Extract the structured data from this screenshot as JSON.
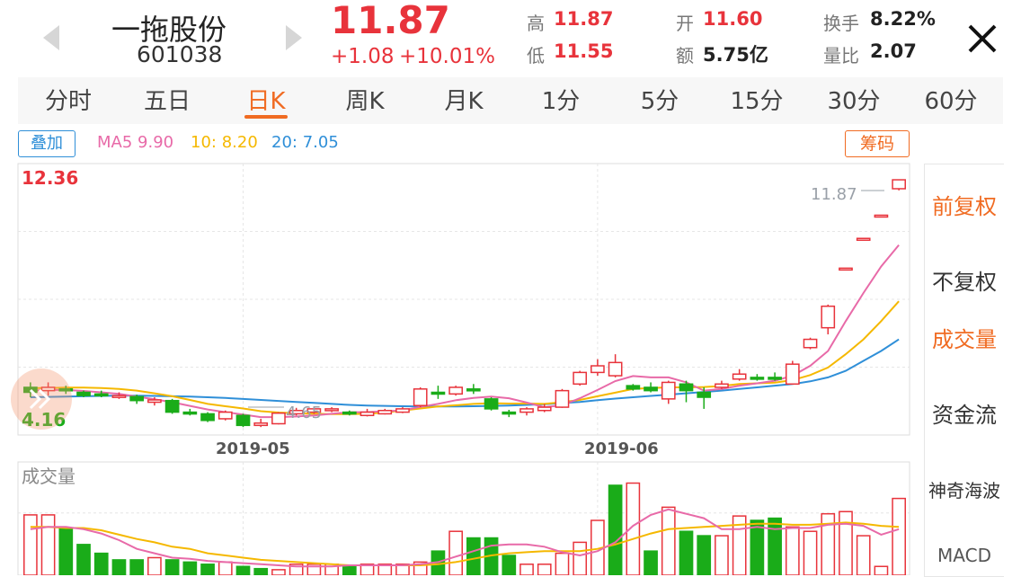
{
  "header": {
    "stock_name": "一拖股份",
    "stock_code": "601038",
    "price": "11.87",
    "change": "+1.08",
    "change_pct": "+10.01%",
    "stats": [
      {
        "label": "高",
        "value": "11.87",
        "red": true
      },
      {
        "label": "开",
        "value": "11.60",
        "red": true
      },
      {
        "label": "换手",
        "value": "8.22%",
        "red": false
      },
      {
        "label": "低",
        "value": "11.55",
        "red": true
      },
      {
        "label": "额",
        "value": "5.75亿",
        "red": false
      },
      {
        "label": "量比",
        "value": "2.07",
        "red": false
      }
    ],
    "close_icon": "close-icon",
    "prev_icon": "chevron-left-icon",
    "next_icon": "chevron-right-icon"
  },
  "tabs": [
    {
      "label": "分时",
      "active": false
    },
    {
      "label": "五日",
      "active": false
    },
    {
      "label": "日K",
      "active": true
    },
    {
      "label": "周K",
      "active": false
    },
    {
      "label": "月K",
      "active": false
    },
    {
      "label": "1分",
      "active": false
    },
    {
      "label": "5分",
      "active": false
    },
    {
      "label": "15分",
      "active": false
    },
    {
      "label": "30分",
      "active": false
    },
    {
      "label": "60分",
      "active": false
    }
  ],
  "indicator_bar": {
    "overlay_button": "叠加",
    "ma5": "MA5 9.90",
    "ma10": "10: 8.20",
    "ma20": "20: 7.05",
    "chips_button": "筹码"
  },
  "side_menu": [
    {
      "label": "前复权",
      "active": true
    },
    {
      "label": "不复权",
      "active": false
    },
    {
      "label": "成交量",
      "active": true
    },
    {
      "label": "资金流",
      "active": false
    },
    {
      "label": "神奇海波",
      "active": false
    },
    {
      "label": "MACD",
      "active": false
    }
  ],
  "colors": {
    "up": "#e8333b",
    "down": "#1aac19",
    "ma5": "#e86aa8",
    "ma10": "#f5b800",
    "ma20": "#2f8fd8",
    "accent": "#f06b22"
  },
  "chart_data": [
    {
      "type": "candlestick",
      "ylim": [
        4.16,
        12.36
      ],
      "max_label": "12.36",
      "min_label": "4.16",
      "high_annotation": "11.87",
      "low_annotation": "4.65",
      "x_ticks": [
        "2019-05",
        "2019-06"
      ],
      "x_tick_index": [
        12,
        32
      ],
      "candles": [
        [
          5.6,
          5.45,
          5.75,
          5.3
        ],
        [
          5.5,
          5.6,
          5.75,
          5.35
        ],
        [
          5.55,
          5.5,
          5.65,
          5.4
        ],
        [
          5.45,
          5.35,
          5.5,
          5.3
        ],
        [
          5.4,
          5.38,
          5.5,
          5.3
        ],
        [
          5.35,
          5.35,
          5.45,
          5.25
        ],
        [
          5.32,
          5.2,
          5.38,
          5.1
        ],
        [
          5.15,
          5.22,
          5.3,
          5.05
        ],
        [
          5.2,
          4.85,
          5.25,
          4.8
        ],
        [
          4.85,
          4.83,
          4.95,
          4.75
        ],
        [
          4.8,
          4.6,
          4.85,
          4.55
        ],
        [
          4.65,
          4.85,
          4.9,
          4.6
        ],
        [
          4.75,
          4.45,
          4.8,
          4.4
        ],
        [
          4.45,
          4.52,
          4.65,
          4.4
        ],
        [
          4.5,
          4.82,
          4.85,
          4.48
        ],
        [
          4.8,
          4.9,
          4.98,
          4.75
        ],
        [
          4.85,
          4.95,
          5.0,
          4.8
        ],
        [
          4.9,
          4.95,
          5.0,
          4.85
        ],
        [
          4.85,
          4.8,
          4.9,
          4.75
        ],
        [
          4.75,
          4.85,
          4.95,
          4.72
        ],
        [
          4.8,
          4.9,
          4.95,
          4.78
        ],
        [
          4.85,
          4.95,
          5.0,
          4.82
        ],
        [
          5.05,
          5.55,
          5.6,
          5.0
        ],
        [
          5.45,
          5.4,
          5.65,
          5.25
        ],
        [
          5.4,
          5.6,
          5.65,
          5.35
        ],
        [
          5.55,
          5.5,
          5.7,
          5.4
        ],
        [
          5.25,
          4.95,
          5.3,
          4.9
        ],
        [
          4.85,
          4.82,
          4.92,
          4.7
        ],
        [
          4.85,
          4.95,
          5.0,
          4.75
        ],
        [
          4.9,
          5.0,
          5.1,
          4.85
        ],
        [
          5.0,
          5.5,
          5.55,
          4.98
        ],
        [
          5.7,
          6.05,
          6.1,
          5.65
        ],
        [
          6.05,
          6.25,
          6.45,
          5.95
        ],
        [
          5.95,
          6.35,
          6.6,
          5.9
        ],
        [
          5.65,
          5.55,
          5.7,
          5.5
        ],
        [
          5.6,
          5.5,
          5.75,
          5.45
        ],
        [
          5.25,
          5.75,
          5.8,
          5.1
        ],
        [
          5.7,
          5.5,
          5.8,
          5.15
        ],
        [
          5.45,
          5.3,
          5.6,
          4.95
        ],
        [
          5.6,
          5.7,
          5.8,
          5.55
        ],
        [
          5.85,
          6.0,
          6.15,
          5.8
        ],
        [
          5.9,
          5.85,
          6.0,
          5.8
        ],
        [
          5.9,
          5.85,
          6.05,
          5.8
        ],
        [
          5.7,
          6.3,
          6.4,
          5.7
        ],
        [
          6.8,
          7.05,
          7.1,
          6.75
        ],
        [
          7.4,
          8.05,
          8.1,
          7.2
        ],
        [
          9.2,
          9.2,
          9.2,
          9.2
        ],
        [
          10.1,
          10.1,
          10.1,
          10.1
        ],
        [
          10.8,
          10.8,
          10.8,
          10.8
        ],
        [
          11.6,
          11.87,
          11.87,
          11.55
        ]
      ],
      "ma5": [
        5.5,
        5.52,
        5.52,
        5.49,
        5.45,
        5.4,
        5.32,
        5.24,
        5.15,
        5.04,
        4.93,
        4.85,
        4.78,
        4.7,
        4.7,
        4.72,
        4.75,
        4.8,
        4.85,
        4.85,
        4.88,
        4.9,
        5.01,
        5.1,
        5.21,
        5.28,
        5.32,
        5.27,
        5.14,
        5.0,
        5.06,
        5.27,
        5.52,
        5.79,
        5.94,
        5.9,
        5.9,
        5.75,
        5.5,
        5.55,
        5.65,
        5.72,
        5.8,
        5.95,
        6.25,
        6.7,
        7.6,
        8.45,
        9.25,
        9.9
      ],
      "ma10": [
        5.58,
        5.58,
        5.59,
        5.59,
        5.58,
        5.55,
        5.5,
        5.42,
        5.33,
        5.22,
        5.1,
        5.03,
        4.96,
        4.88,
        4.84,
        4.82,
        4.8,
        4.79,
        4.79,
        4.8,
        4.84,
        4.9,
        4.96,
        5.02,
        5.06,
        5.1,
        5.12,
        5.11,
        5.11,
        5.1,
        5.15,
        5.22,
        5.33,
        5.44,
        5.55,
        5.58,
        5.6,
        5.6,
        5.61,
        5.64,
        5.7,
        5.72,
        5.74,
        5.82,
        5.97,
        6.2,
        6.6,
        7.05,
        7.6,
        8.2
      ],
      "ma20": [
        5.3,
        5.31,
        5.32,
        5.33,
        5.34,
        5.35,
        5.35,
        5.34,
        5.33,
        5.32,
        5.3,
        5.28,
        5.25,
        5.22,
        5.19,
        5.16,
        5.13,
        5.1,
        5.07,
        5.05,
        5.04,
        5.03,
        5.02,
        5.02,
        5.02,
        5.03,
        5.04,
        5.05,
        5.07,
        5.09,
        5.12,
        5.16,
        5.21,
        5.26,
        5.3,
        5.34,
        5.38,
        5.42,
        5.46,
        5.5,
        5.55,
        5.6,
        5.65,
        5.7,
        5.78,
        5.9,
        6.1,
        6.4,
        6.7,
        7.05
      ]
    },
    {
      "type": "bar",
      "title": "成交量",
      "values": [
        55,
        55,
        42,
        28,
        20,
        14,
        14,
        16,
        14,
        12,
        10,
        12,
        8,
        6,
        5,
        10,
        10,
        10,
        8,
        10,
        10,
        10,
        12,
        22,
        40,
        34,
        34,
        18,
        10,
        10,
        20,
        30,
        50,
        82,
        84,
        22,
        62,
        40,
        36,
        36,
        54,
        50,
        52,
        44,
        40,
        56,
        58,
        36,
        8,
        70
      ],
      "up": [
        true,
        true,
        false,
        false,
        false,
        false,
        false,
        true,
        false,
        false,
        false,
        true,
        false,
        false,
        true,
        true,
        true,
        true,
        false,
        true,
        true,
        true,
        true,
        false,
        true,
        false,
        false,
        false,
        true,
        true,
        true,
        true,
        true,
        false,
        true,
        false,
        true,
        false,
        false,
        true,
        true,
        false,
        false,
        true,
        true,
        true,
        true,
        true,
        true,
        true
      ],
      "ma5": [
        42,
        44,
        44,
        42,
        38,
        32,
        24,
        20,
        16,
        15,
        13,
        12,
        11,
        10,
        9,
        8,
        8,
        8,
        9,
        9,
        9,
        9,
        10,
        12,
        17,
        22,
        27,
        28,
        28,
        26,
        21,
        18,
        22,
        30,
        45,
        55,
        60,
        56,
        52,
        42,
        42,
        44,
        42,
        43,
        43,
        46,
        47,
        45,
        37,
        42
      ],
      "ma10": [
        44,
        44,
        43,
        43,
        41,
        37,
        33,
        30,
        26,
        24,
        20,
        18,
        16,
        14,
        13,
        12,
        11,
        10,
        9,
        9,
        9,
        9,
        9,
        10,
        12,
        15,
        18,
        20,
        21,
        22,
        22,
        22,
        24,
        28,
        33,
        38,
        42,
        43,
        44,
        45,
        46,
        47,
        47,
        46,
        46,
        47,
        48,
        47,
        45,
        44
      ]
    }
  ]
}
